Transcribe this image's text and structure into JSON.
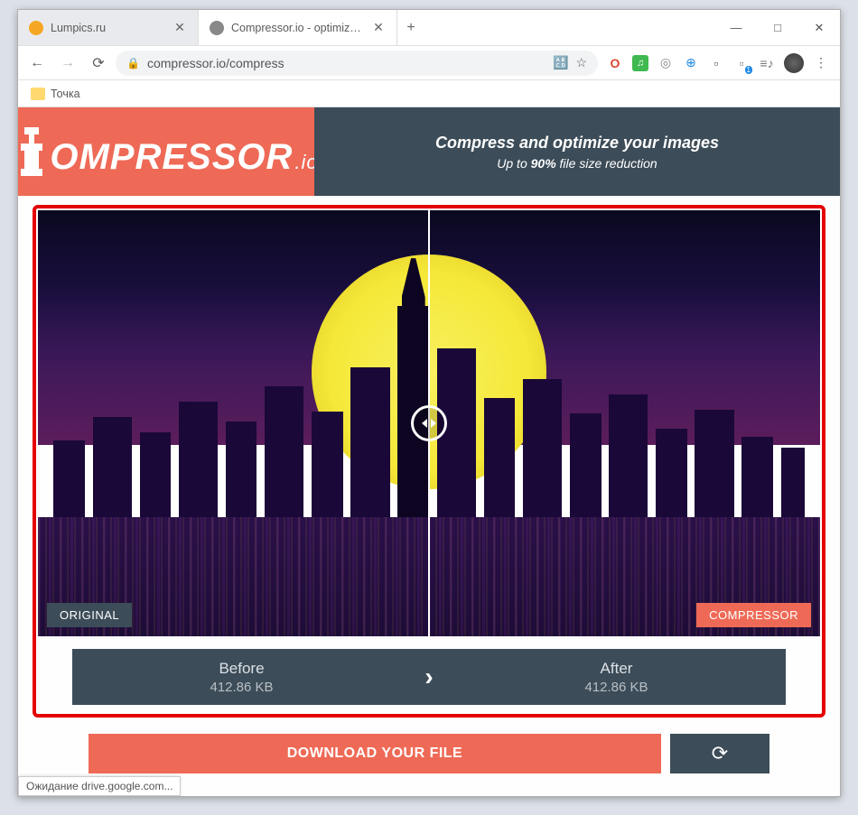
{
  "window": {
    "minimize": "—",
    "maximize": "□",
    "close": "✕"
  },
  "tabs": [
    {
      "title": "Lumpics.ru",
      "favicon_color": "#f5a623",
      "active": false
    },
    {
      "title": "Compressor.io - optimize and co",
      "favicon_color": "#888",
      "active": true
    }
  ],
  "new_tab": "+",
  "navigation": {
    "back": "←",
    "forward": "→",
    "reload": "⟳",
    "url": "compressor.io/compress",
    "star": "☆",
    "translate": "⠿"
  },
  "extensions": [
    {
      "name": "ext1",
      "color": "#d9452e",
      "glyph": "O"
    },
    {
      "name": "ext2",
      "color": "#3fb950",
      "glyph": "♫"
    },
    {
      "name": "ext3",
      "color": "#999",
      "glyph": "◎"
    },
    {
      "name": "ext4",
      "color": "#1e88e5",
      "glyph": "⊕"
    },
    {
      "name": "ext5",
      "color": "#555",
      "glyph": "📦"
    },
    {
      "name": "ext6",
      "color": "#777",
      "glyph": "⊞"
    },
    {
      "name": "ext7",
      "color": "#777",
      "glyph": "≡"
    }
  ],
  "profile_glyph": "●",
  "menu_dots": "⋮",
  "bookmarks": [
    {
      "label": "Точка"
    }
  ],
  "header": {
    "logo_text": "OMPRESSOR",
    "logo_suffix": ".io",
    "slogan_main": "Compress and optimize your images",
    "slogan_sub_pre": "Up to ",
    "slogan_sub_bold": "90%",
    "slogan_sub_post": " file size reduction"
  },
  "compare": {
    "original_label": "ORIGINAL",
    "compressor_label": "COMPRESSOR"
  },
  "sizes": {
    "before_label": "Before",
    "before_value": "412.86 KB",
    "arrow": "›",
    "after_label": "After",
    "after_value": "412.86 KB"
  },
  "download": {
    "main": "DOWNLOAD YOUR FILE",
    "retry": "⟳"
  },
  "status_text": "Ожидание drive.google.com..."
}
